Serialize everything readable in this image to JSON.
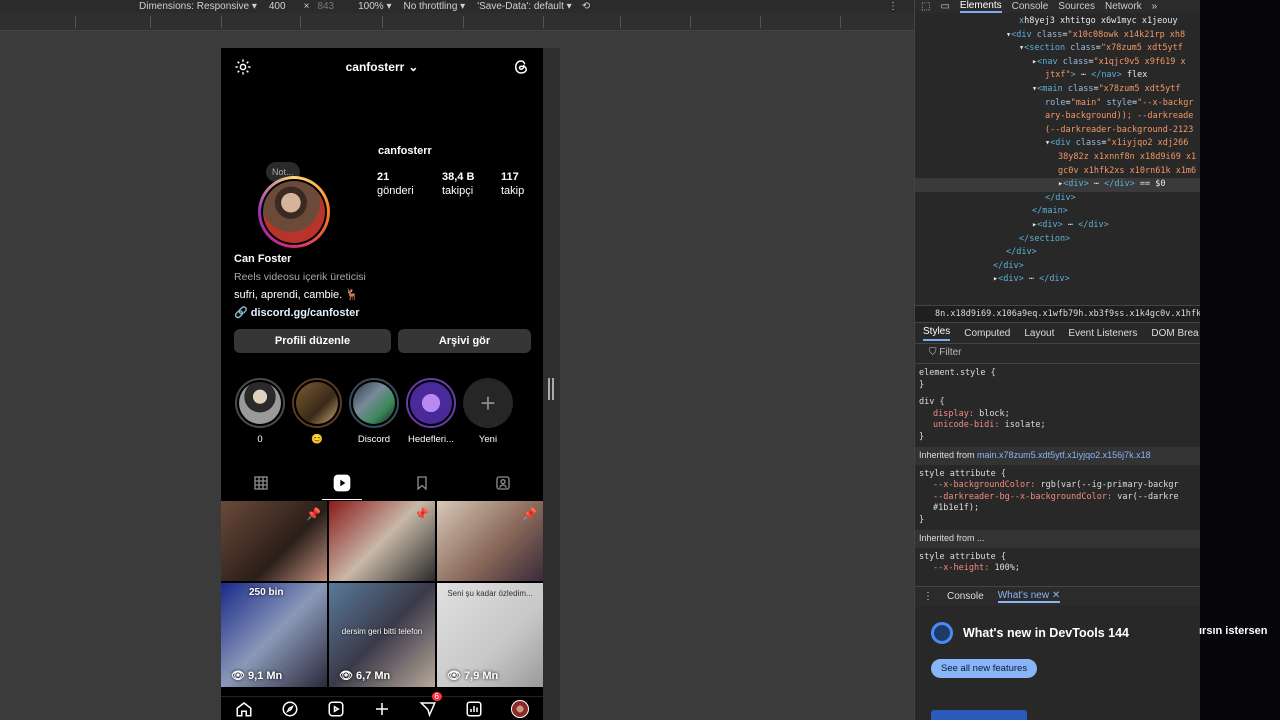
{
  "device_toolbar": {
    "dimensions_label": "Dimensions: Responsive",
    "width": "400",
    "times": "×",
    "height": "843",
    "zoom": "100%",
    "throttling": "No throttling",
    "save_data": "'Save-Data': default"
  },
  "instagram": {
    "username": "canfosterr",
    "profile_handle": "canfosterr",
    "note": "Not...",
    "stats": [
      {
        "value": "21",
        "label": "gönderi"
      },
      {
        "value": "38,4 B",
        "label": "takipçi"
      },
      {
        "value": "117",
        "label": "takip"
      }
    ],
    "display_name": "Can Foster",
    "category": "Reels videosu içerik üreticisi",
    "bio_text": "sufri, aprendi, cambie. 🦌",
    "link": "discord.gg/canfoster",
    "edit_profile": "Profili düzenle",
    "view_archive": "Arşivi gör",
    "highlights": [
      {
        "label": "0",
        "color": "#4a4a4a"
      },
      {
        "label": "😊",
        "color": "#5a3a22"
      },
      {
        "label": "Discord",
        "color": "#3c4a5a"
      },
      {
        "label": "Hedefleri...",
        "color": "#6a3aa8"
      }
    ],
    "new_highlight": "Yeni",
    "posts": [
      {
        "views": "",
        "overlay": "",
        "pinned": true,
        "bg": "linear-gradient(135deg,#6b4a3a,#2a1e18 60%,#c09080)"
      },
      {
        "views": "",
        "overlay": "",
        "pinned": true,
        "bg": "linear-gradient(135deg,#8a1a1a,#c8b8a8 50%,#2a2a2a)"
      },
      {
        "views": "",
        "overlay": "",
        "pinned": true,
        "bg": "linear-gradient(135deg,#d8c8b8,#8a6a5a 55%,#3a2a3a)"
      },
      {
        "views": "9,1 Mn",
        "overlay": "250 bin",
        "pinned": false,
        "bg": "linear-gradient(135deg,#1a2a8a,#8a98b8 50%,#2a2a3a)"
      },
      {
        "views": "6,7 Mn",
        "overlay": "dersim geri bitti telefon",
        "pinned": false,
        "bg": "linear-gradient(135deg,#5a7a9a,#3a3a4a 50%,#b8a898)"
      },
      {
        "views": "7,9 Mn",
        "overlay": "Seni şu kadar özledim...",
        "pinned": false,
        "bg": "linear-gradient(135deg,#e0e0e0,#c8c8c8 60%,#9a9a9a)"
      }
    ],
    "message_badge": "6"
  },
  "devtools": {
    "tabs": [
      "Elements",
      "Console",
      "Sources",
      "Network"
    ],
    "active_tab": "Elements",
    "dom_lines": [
      {
        "indent": 8,
        "html": "<span class='tag'>x</span>h8yej3 xhtitgo x6w1myc x1jeouy"
      },
      {
        "indent": 7,
        "html": "▾<span class='tag'>&lt;div</span> <span class='attr'>class</span>=<span class='val'>\"x10c08owk x14k21rp xh8</span>"
      },
      {
        "indent": 8,
        "html": "▾<span class='tag'>&lt;section</span> <span class='attr'>class</span>=<span class='val'>\"x78zum5 xdt5ytf</span>"
      },
      {
        "indent": 9,
        "html": "▸<span class='tag'>&lt;nav</span> <span class='attr'>class</span>=<span class='val'>\"x1qjc9v5 x9f619 x</span>"
      },
      {
        "indent": 10,
        "html": "<span class='val'>jtxf\"</span><span class='tag'>&gt;</span> ⋯ <span class='tag'>&lt;/nav&gt;</span> flex"
      },
      {
        "indent": 9,
        "html": "▾<span class='tag'>&lt;main</span> <span class='attr'>class</span>=<span class='val'>\"x78zum5 xdt5ytf</span>"
      },
      {
        "indent": 10,
        "html": "<span class='attr'>role</span>=<span class='val'>\"main\"</span> <span class='attr'>style</span>=<span class='val'>\"--x-backgr</span>"
      },
      {
        "indent": 10,
        "html": "<span class='val'>ary-background)); --darkreade</span>"
      },
      {
        "indent": 10,
        "html": "<span class='val'>(--darkreader-background-2123</span>"
      },
      {
        "indent": 10,
        "html": "▾<span class='tag'>&lt;div</span> <span class='attr'>class</span>=<span class='val'>\"x1iyjqo2 xdj266</span>"
      },
      {
        "indent": 11,
        "html": "<span class='val'>38y82z x1xnnf8n x18d9i69 x1</span>"
      },
      {
        "indent": 11,
        "html": "<span class='val'>gc0v x1hfk2xs x10rn61k x1m6</span>"
      },
      {
        "indent": 11,
        "html": "▸<span class='tag'>&lt;div&gt;</span> ⋯ <span class='tag'>&lt;/div&gt;</span> == $0",
        "sel": true
      },
      {
        "indent": 10,
        "html": "<span class='tag'>&lt;/div&gt;</span>"
      },
      {
        "indent": 9,
        "html": "<span class='tag'>&lt;/main&gt;</span>"
      },
      {
        "indent": 9,
        "html": "▸<span class='tag'>&lt;div&gt;</span> ⋯ <span class='tag'>&lt;/div&gt;</span>"
      },
      {
        "indent": 8,
        "html": "<span class='tag'>&lt;/section&gt;</span>"
      },
      {
        "indent": 7,
        "html": "<span class='tag'>&lt;/div&gt;</span>"
      },
      {
        "indent": 6,
        "html": "<span class='tag'>&lt;/div&gt;</span>"
      },
      {
        "indent": 6,
        "html": "▸<span class='tag'>&lt;div&gt;</span> ⋯ <span class='tag'>&lt;/div&gt;</span>"
      }
    ],
    "breadcrumb": "8n.x18d9i69.x106a9eq.x1wfb79h.xb3f9ss.x1k4gc0v.x1hfk2xs.x1",
    "sub_tabs": [
      "Styles",
      "Computed",
      "Layout",
      "Event Listeners",
      "DOM Brea"
    ],
    "filter_label": "Filter",
    "styles": {
      "element_style": "element.style {",
      "div_rule": "div {",
      "display_prop": "display",
      "display_val": "block;",
      "unicode_prop": "unicode-bidi",
      "unicode_val": "isolate;",
      "inherited_label": "Inherited from",
      "inherited_link": "main.x78zum5.xdt5ytf.x1iyjqo2.x156j7k.x18",
      "style_attr": "style attribute {",
      "bg_prop": "--x-backgroundColor",
      "bg_val": "rgb(var(--ig-primary-backgr",
      "dr_prop": "--darkreader-bg--x-backgroundColor",
      "dr_val": "var(--darkre",
      "dr_val2": "#1b1e1f);",
      "inherited2": "Inherited from ...",
      "height_prop": "--x-height",
      "height_val": "100%;"
    },
    "drawer_tabs": [
      "Console",
      "What's new"
    ],
    "whats_new_title": "What's new in DevTools 144",
    "see_all": "See all new features"
  },
  "subtitle": "ırsın istersen"
}
